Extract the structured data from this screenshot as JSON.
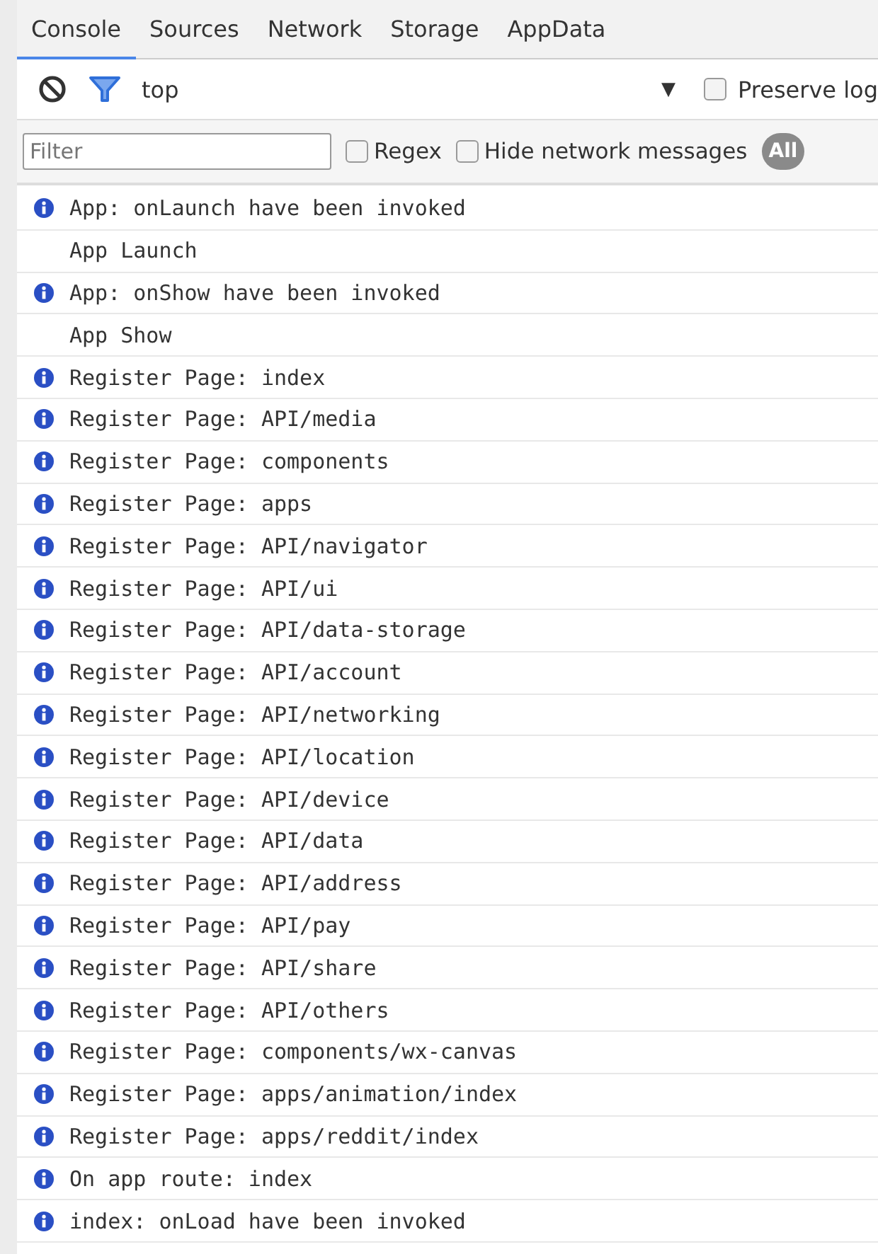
{
  "tabs": [
    {
      "label": "Console",
      "selected": true
    },
    {
      "label": "Sources",
      "selected": false
    },
    {
      "label": "Network",
      "selected": false
    },
    {
      "label": "Storage",
      "selected": false
    },
    {
      "label": "AppData",
      "selected": false
    }
  ],
  "toolbar": {
    "context": "top",
    "dropdown_arrow": "▼",
    "preserve_log": {
      "label": "Preserve log",
      "checked": false
    }
  },
  "filter_bar": {
    "placeholder": "Filter",
    "options": [
      {
        "label": "Regex",
        "checked": false
      },
      {
        "label": "Hide network messages",
        "checked": false
      }
    ],
    "level_button": {
      "label": "All",
      "selected": true
    }
  },
  "messages": [
    {
      "kind": "info",
      "text": "App: onLaunch have been invoked"
    },
    {
      "kind": "log",
      "text": "App Launch"
    },
    {
      "kind": "info",
      "text": "App: onShow have been invoked"
    },
    {
      "kind": "log",
      "text": "App Show"
    },
    {
      "kind": "info",
      "text": "Register Page: index"
    },
    {
      "kind": "info",
      "text": "Register Page: API/media"
    },
    {
      "kind": "info",
      "text": "Register Page: components"
    },
    {
      "kind": "info",
      "text": "Register Page: apps"
    },
    {
      "kind": "info",
      "text": "Register Page: API/navigator"
    },
    {
      "kind": "info",
      "text": "Register Page: API/ui"
    },
    {
      "kind": "info",
      "text": "Register Page: API/data-storage"
    },
    {
      "kind": "info",
      "text": "Register Page: API/account"
    },
    {
      "kind": "info",
      "text": "Register Page: API/networking"
    },
    {
      "kind": "info",
      "text": "Register Page: API/location"
    },
    {
      "kind": "info",
      "text": "Register Page: API/device"
    },
    {
      "kind": "info",
      "text": "Register Page: API/data"
    },
    {
      "kind": "info",
      "text": "Register Page: API/address"
    },
    {
      "kind": "info",
      "text": "Register Page: API/pay"
    },
    {
      "kind": "info",
      "text": "Register Page: API/share"
    },
    {
      "kind": "info",
      "text": "Register Page: API/others"
    },
    {
      "kind": "info",
      "text": "Register Page: components/wx-canvas"
    },
    {
      "kind": "info",
      "text": "Register Page: apps/animation/index"
    },
    {
      "kind": "info",
      "text": "Register Page: apps/reddit/index"
    },
    {
      "kind": "info",
      "text": "On app route: index"
    },
    {
      "kind": "info",
      "text": "index: onLoad have been invoked"
    }
  ]
}
